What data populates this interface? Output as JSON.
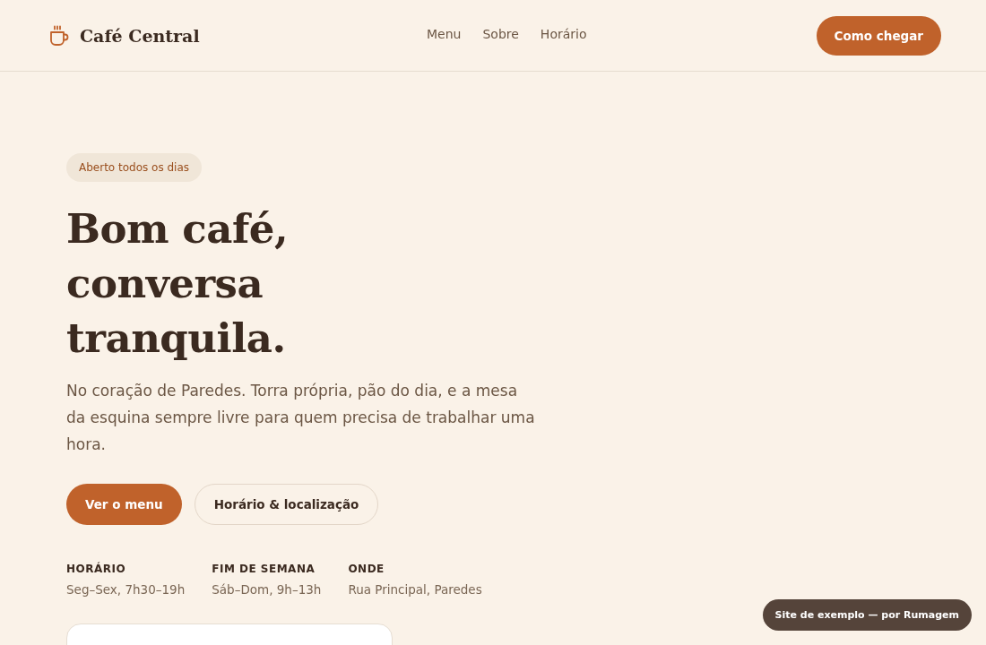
{
  "header": {
    "brand": "Café Central",
    "nav": [
      {
        "label": "Menu"
      },
      {
        "label": "Sobre"
      },
      {
        "label": "Horário"
      }
    ],
    "cta": "Como chegar"
  },
  "hero": {
    "badge": "Aberto todos os dias",
    "title_lines": [
      "Bom café,",
      "conversa",
      "tranquila."
    ],
    "lead": "No coração de Paredes. Torra própria, pão do dia, e a mesa da esquina sempre livre para quem precisa de trabalhar uma hora.",
    "buttons": [
      {
        "label": "Ver o menu",
        "kind": "primary"
      },
      {
        "label": "Horário & localização",
        "kind": "secondary"
      }
    ],
    "info": [
      {
        "label": "HORÁRIO",
        "value": "Seg–Sex, 7h30–19h"
      },
      {
        "label": "FIM DE SEMANA",
        "value": "Sáb–Dom, 9h–13h"
      },
      {
        "label": "ONDE",
        "value": "Rua Principal, Paredes"
      }
    ]
  },
  "footer_badge": "Site de exemplo — por Rumagem"
}
